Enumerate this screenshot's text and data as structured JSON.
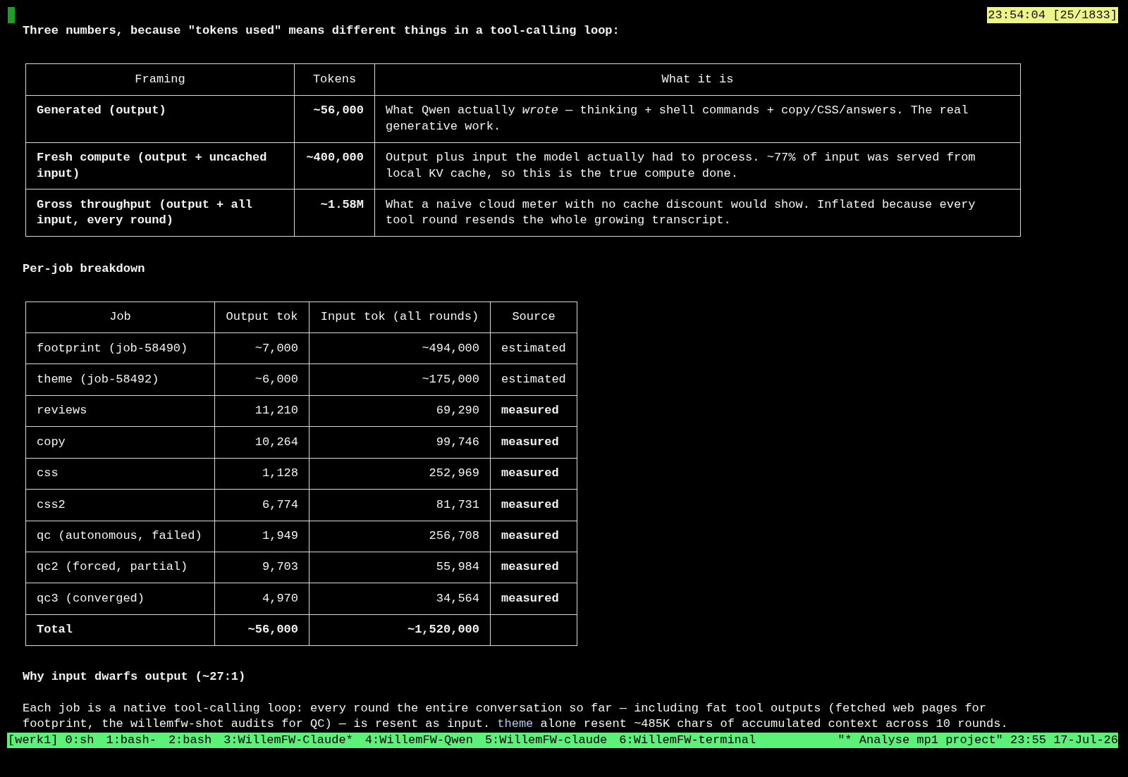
{
  "terminal": {
    "timestamp": "23:54:04 [25/1833]"
  },
  "intro": "Three numbers, because \"tokens used\" means different things in a tool-calling loop:",
  "framing_table": {
    "columns": [
      "Framing",
      "Tokens",
      "What it is"
    ],
    "rows": [
      {
        "framing": "Generated (output)",
        "tokens": "~56,000",
        "description": "What Qwen actually *wrote* — thinking + shell commands + copy/CSS/answers. The real generative work."
      },
      {
        "framing": "Fresh compute (output + uncached input)",
        "tokens": "~400,000",
        "description": "Output plus input the model actually had to process. ~77% of input was served from local KV cache, so this is the true compute done."
      },
      {
        "framing": "Gross throughput (output + all input, every round)",
        "tokens": "~1.58M",
        "description": "What a naive cloud meter with no cache discount would show. Inflated because every tool round resends the whole growing transcript."
      }
    ]
  },
  "per_job": {
    "heading": "Per-job breakdown",
    "table": {
      "columns": [
        "Job",
        "Output tok",
        "Input tok (all rounds)",
        "Source"
      ],
      "rows": [
        {
          "kind": "job",
          "job": "footprint (job-58490)",
          "output": "~7,000",
          "input": "~494,000",
          "source": "estimated",
          "measured": false
        },
        {
          "kind": "job",
          "job": "theme (job-58492)",
          "output": "~6,000",
          "input": "~175,000",
          "source": "estimated",
          "measured": false
        },
        {
          "kind": "job",
          "job": "reviews",
          "output": "11,210",
          "input": "69,290",
          "source": "measured",
          "measured": true
        },
        {
          "kind": "job",
          "job": "copy",
          "output": "10,264",
          "input": "99,746",
          "source": "measured",
          "measured": true
        },
        {
          "kind": "job",
          "job": "css",
          "output": "1,128",
          "input": "252,969",
          "source": "measured",
          "measured": true
        },
        {
          "kind": "job",
          "job": "css2",
          "output": "6,774",
          "input": "81,731",
          "source": "measured",
          "measured": true
        },
        {
          "kind": "job",
          "job": "qc (autonomous, failed)",
          "output": "1,949",
          "input": "256,708",
          "source": "measured",
          "measured": true
        },
        {
          "kind": "job",
          "job": "qc2 (forced, partial)",
          "output": "9,703",
          "input": "55,984",
          "source": "measured",
          "measured": true
        },
        {
          "kind": "job",
          "job": "qc3 (converged)",
          "output": "4,970",
          "input": "34,564",
          "source": "measured",
          "measured": true
        },
        {
          "kind": "total",
          "job": "Total",
          "output": "~56,000",
          "input": "~1,520,000"
        }
      ]
    }
  },
  "why": {
    "heading": "Why input dwarfs output (~27:1)",
    "paragraph": [
      {
        "kind": "text",
        "text": "Each job is a native tool-calling loop: every round the entire conversation so far — including fat tool outputs (fetched web pages for footprint, the willemfw-shot audits for QC) — is resent as input. "
      },
      {
        "kind": "code",
        "text": "theme"
      },
      {
        "kind": "text",
        "text": " alone resent ~485K chars of accumulated context across 10 rounds."
      }
    ]
  },
  "status_bar": {
    "session": "[werk1]",
    "windows": [
      "0:sh",
      "1:bash-",
      "2:bash",
      "3:WillemFW-Claude*",
      "4:WillemFW-Qwen",
      "5:WillemFW-claude",
      "6:WillemFW-terminal"
    ],
    "title": "\"* Analyse mp1 project\"",
    "time": "23:55",
    "date": "17-Jul-26"
  }
}
